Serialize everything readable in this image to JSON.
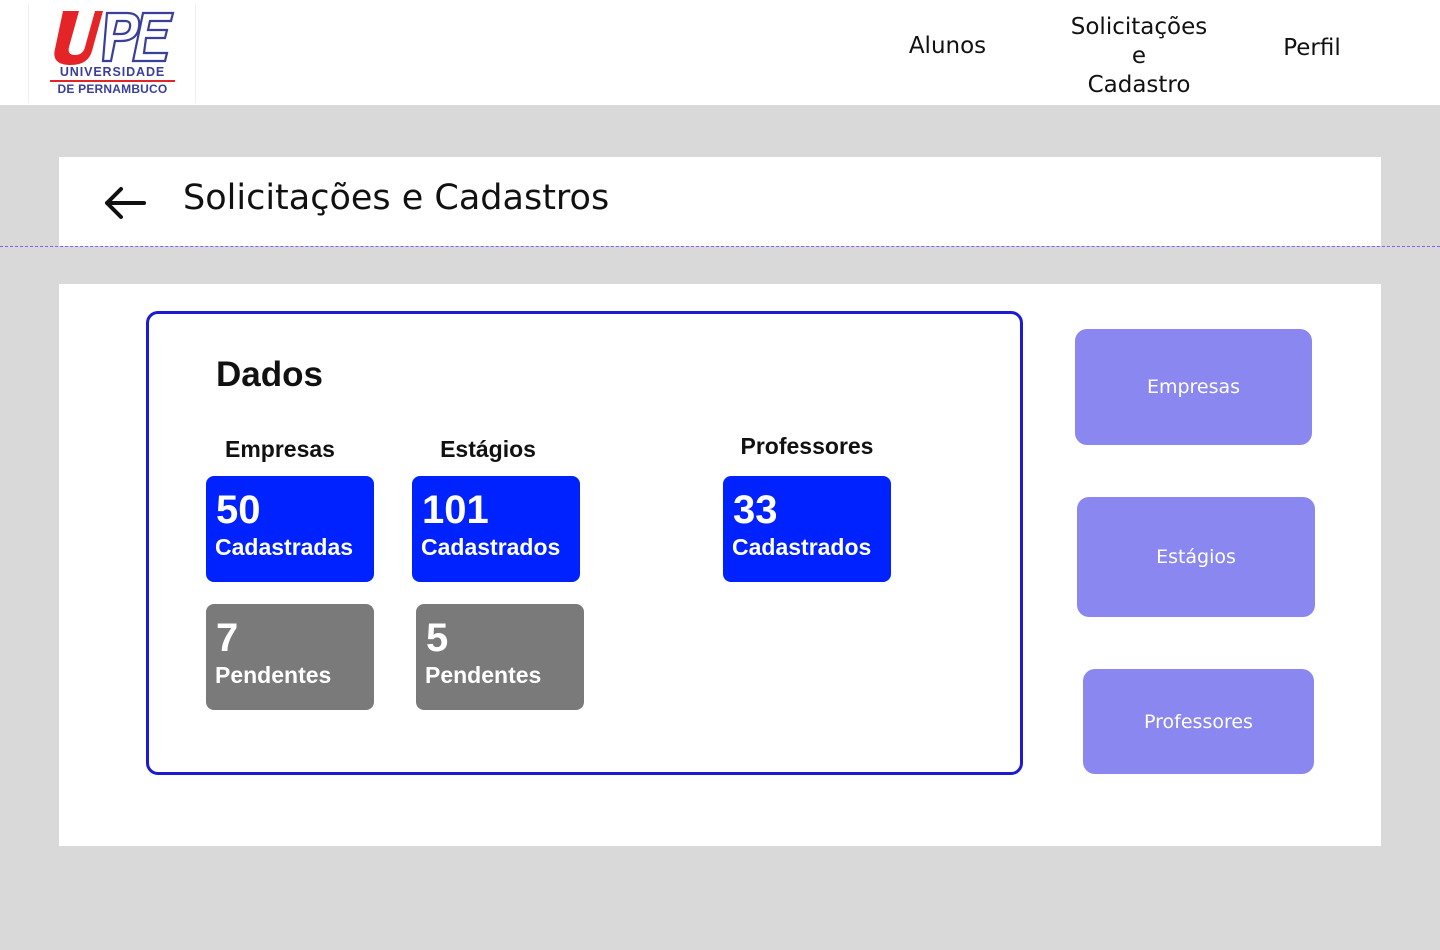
{
  "logo": {
    "mark": "UPE",
    "line1": "UNIVERSIDADE",
    "line2": "DE PERNAMBUCO",
    "colors": {
      "red": "#e52428",
      "navy": "#3a3f9a"
    }
  },
  "nav": {
    "alunos": "Alunos",
    "solicitacoes_line1": "Solicitações",
    "solicitacoes_line2": "e",
    "solicitacoes_line3": "Cadastro",
    "perfil": "Perfil"
  },
  "header": {
    "back_icon": "arrow-left-icon",
    "title": "Solicitações e Cadastros"
  },
  "dados": {
    "title": "Dados",
    "empresas": {
      "label": "Empresas",
      "cadastradas_value": "50",
      "cadastradas_label": "Cadastradas",
      "pendentes_value": "7",
      "pendentes_label": "Pendentes"
    },
    "estagios": {
      "label": "Estágios",
      "cadastrados_value": "101",
      "cadastrados_label": "Cadastrados",
      "pendentes_value": "5",
      "pendentes_label": "Pendentes"
    },
    "professores": {
      "label": "Professores",
      "cadastrados_value": "33",
      "cadastrados_label": "Cadastrados"
    }
  },
  "side_buttons": {
    "empresas": "Empresas",
    "estagios": "Estágios",
    "professores": "Professores"
  },
  "colors": {
    "stat_blue": "#0022ff",
    "stat_gray": "#7a7a7a",
    "side_button": "#8b87f0",
    "card_border": "#1d1ad6",
    "background": "#d9d9d9"
  }
}
